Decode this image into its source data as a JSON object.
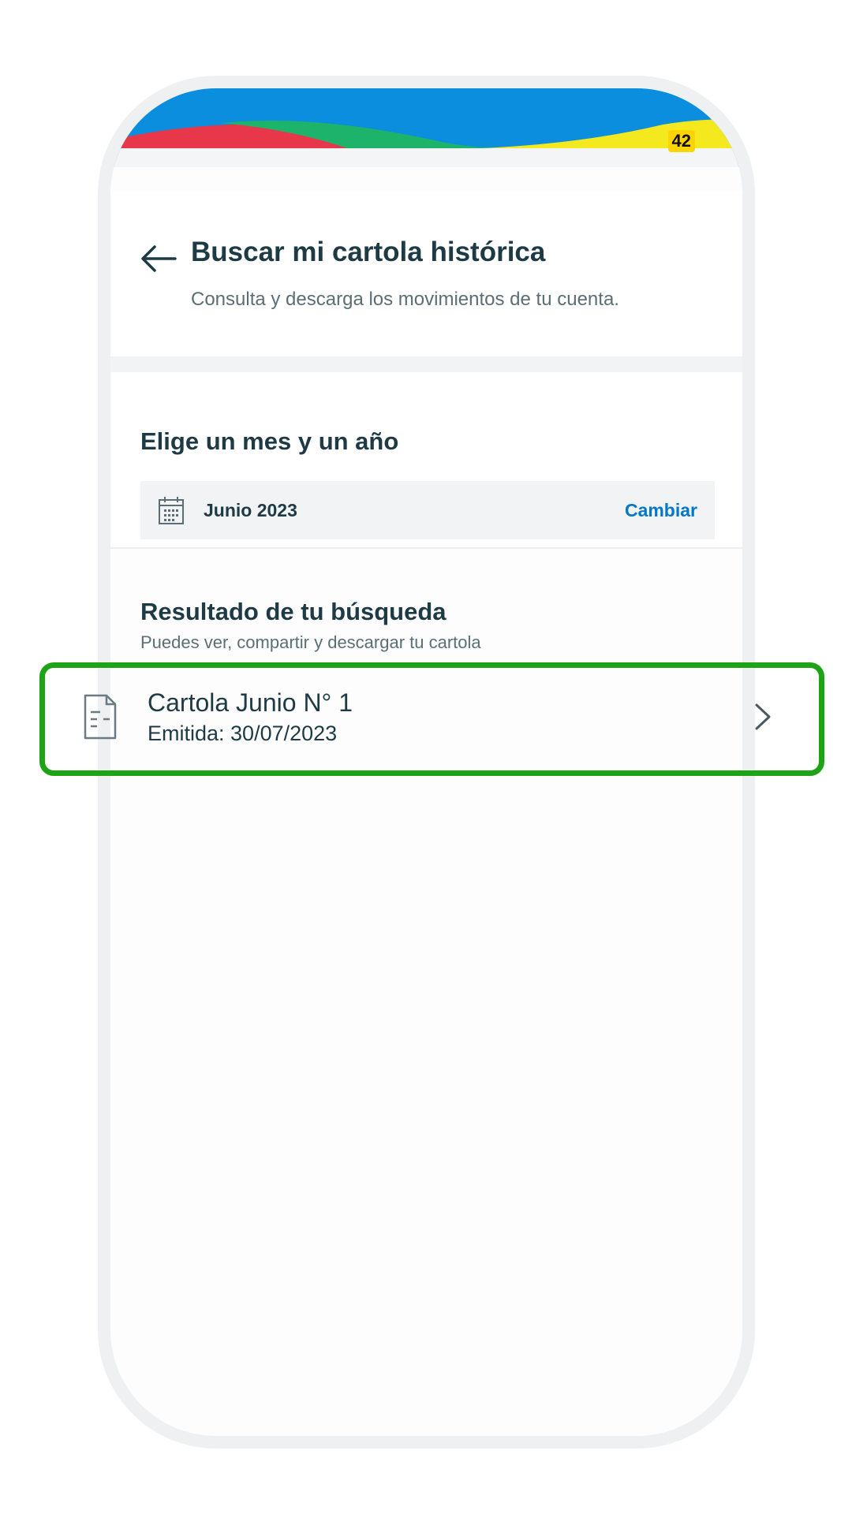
{
  "status_bar": {
    "battery": "42"
  },
  "header": {
    "back_icon": "arrow-left-icon",
    "title": "Buscar mi cartola histórica",
    "subtitle": "Consulta y descarga los movimientos de tu cuenta."
  },
  "month_selector": {
    "title": "Elige un mes y un año",
    "calendar_icon": "calendar-icon",
    "selected": "Junio 2023",
    "change_label": "Cambiar"
  },
  "results": {
    "title": "Resultado de tu búsqueda",
    "subtitle": "Puedes ver, compartir y descargar tu cartola",
    "items": [
      {
        "title": "Cartola Junio N° 1",
        "issued": "Emitida: 30/07/2023",
        "icon": "document-icon"
      }
    ]
  },
  "colors": {
    "accent": "#0077c8",
    "highlight": "#1ea316",
    "header_blue": "#0a8edd",
    "text": "#1e3b45"
  }
}
